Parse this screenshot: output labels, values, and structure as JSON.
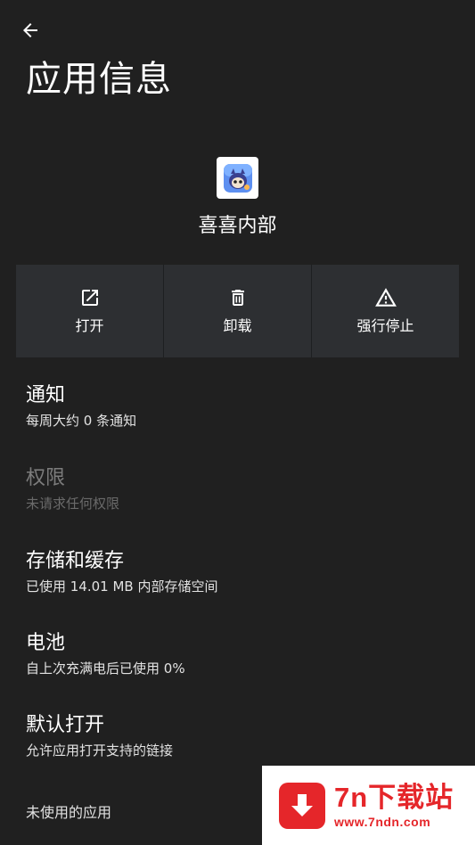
{
  "header": {
    "back_icon": "arrow-left-icon",
    "title": "应用信息"
  },
  "app": {
    "icon": "app-icon",
    "name": "喜喜内部"
  },
  "actions": [
    {
      "label": "打开",
      "icon": "open-external-icon"
    },
    {
      "label": "卸载",
      "icon": "trash-icon"
    },
    {
      "label": "强行停止",
      "icon": "warning-icon"
    }
  ],
  "settings": [
    {
      "title": "通知",
      "subtitle": "每周大约 0 条通知",
      "enabled": true
    },
    {
      "title": "权限",
      "subtitle": "未请求任何权限",
      "enabled": false
    },
    {
      "title": "存储和缓存",
      "subtitle": "已使用 14.01 MB 内部存储空间",
      "enabled": true
    },
    {
      "title": "电池",
      "subtitle": "自上次充满电后已使用 0%",
      "enabled": true
    },
    {
      "title": "默认打开",
      "subtitle": "允许应用打开支持的链接",
      "enabled": true
    },
    {
      "title": "未使用的应用",
      "enabled": true
    }
  ],
  "watermark": {
    "brand": "7n下载站",
    "url": "www.7ndn.com",
    "icon": "download-arrow-icon",
    "color": "#e5262a"
  },
  "colors": {
    "background": "#202020",
    "action_bar": "#2d2f32",
    "text_primary": "#ffffff",
    "text_disabled": "#7c7c7c"
  }
}
